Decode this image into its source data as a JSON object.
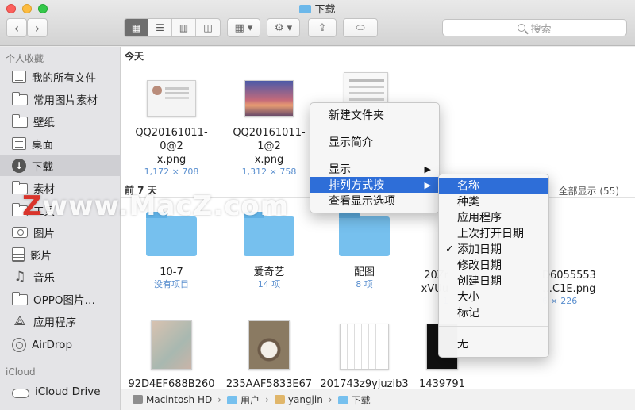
{
  "window": {
    "title": "下载"
  },
  "search": {
    "placeholder": "搜索"
  },
  "sidebar": {
    "favorites_header": "个人收藏",
    "items": [
      {
        "label": "我的所有文件",
        "icon": "all-files-icon"
      },
      {
        "label": "常用图片素材",
        "icon": "folder-icon"
      },
      {
        "label": "壁纸",
        "icon": "folder-icon"
      },
      {
        "label": "桌面",
        "icon": "desktop-icon"
      },
      {
        "label": "下载",
        "icon": "download-icon"
      },
      {
        "label": "素材",
        "icon": "folder-icon"
      },
      {
        "label": "工具",
        "icon": "tools-icon"
      },
      {
        "label": "图片",
        "icon": "camera-icon"
      },
      {
        "label": "影片",
        "icon": "film-icon"
      },
      {
        "label": "音乐",
        "icon": "music-icon"
      },
      {
        "label": "OPPO图片…",
        "icon": "folder-icon"
      },
      {
        "label": "应用程序",
        "icon": "applications-icon"
      },
      {
        "label": "AirDrop",
        "icon": "airdrop-icon"
      }
    ],
    "icloud_header": "iCloud",
    "icloud_items": [
      {
        "label": "iCloud Drive",
        "icon": "cloud-icon"
      }
    ]
  },
  "sections": {
    "today": "今天",
    "last7": "前 7 天",
    "show_all": "全部显示 (55)"
  },
  "files_today": [
    {
      "name1": "QQ20161011-0@2",
      "name2": "x.png",
      "meta": "1,172 × 708"
    },
    {
      "name1": "QQ20161011-1@2",
      "name2": "x.png",
      "meta": "1,312 × 758"
    }
  ],
  "files_week": [
    {
      "name": "10-7",
      "meta": "没有项目"
    },
    {
      "name": "爱奇艺",
      "meta": "14 项"
    },
    {
      "name": "配图",
      "meta": "8 项"
    },
    {
      "name1": "20Zr",
      "name2": "xVUu",
      "meta": "1"
    },
    {
      "name1": "D6055553",
      "name2": "…C1E.png",
      "meta": "6 × 226"
    }
  ],
  "files_row3": [
    {
      "name": "92D4EF688B260"
    },
    {
      "name": "235AAF5833E67"
    },
    {
      "name": "201743z9yjuzib3"
    },
    {
      "name": "1439791"
    }
  ],
  "context_menu": {
    "items": [
      "新建文件夹",
      "显示简介",
      "显示",
      "排列方式按",
      "查看显示选项"
    ]
  },
  "submenu": {
    "items": [
      "名称",
      "种类",
      "应用程序",
      "上次打开日期",
      "添加日期",
      "修改日期",
      "创建日期",
      "大小",
      "标记",
      "无"
    ],
    "checked": "添加日期",
    "highlighted": "名称"
  },
  "pathbar": {
    "segments": [
      "Macintosh HD",
      "用户",
      "yangjin",
      "下载"
    ]
  },
  "watermark": {
    "z": "Z",
    "text": "www.MacZ.com"
  },
  "colors": {
    "highlight": "#2e6ed8",
    "folder": "#76c0ee",
    "meta_text": "#5a8fcf"
  }
}
